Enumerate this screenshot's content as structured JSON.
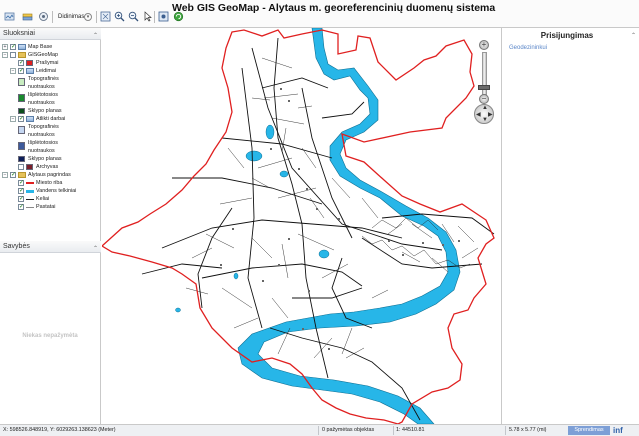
{
  "app": {
    "title": "Web GIS GeoMap - Alytaus m. georeferencinių duomenų sistema"
  },
  "toolbar": {
    "select_value": "Didinimas",
    "icons": [
      "home-icon",
      "layers-icon",
      "settings-icon",
      "zoom-extent-icon",
      "zoom-in-icon",
      "zoom-out-icon",
      "pointer-icon",
      "identify-icon",
      "refresh-icon"
    ]
  },
  "layers_panel": {
    "title": "Sluoksniai",
    "items": [
      {
        "label": "Map Base"
      },
      {
        "label": "GISGeoMap"
      },
      {
        "label": "Prašymai"
      },
      {
        "label": "Leidimai"
      },
      {
        "label": "Topografinės"
      },
      {
        "label": "nuotraukos"
      },
      {
        "label": "Išplėtotosios"
      },
      {
        "label": "nuotraukos"
      },
      {
        "label": "Sklypo planas"
      },
      {
        "label": "Atlikti darbai"
      },
      {
        "label": "Topografinės"
      },
      {
        "label": "nuotraukos"
      },
      {
        "label": "Išplėtotosios"
      },
      {
        "label": "nuotraukos"
      },
      {
        "label": "Sklypo planas"
      },
      {
        "label": "Archyvas"
      },
      {
        "label": "Alytaus pagrindas"
      },
      {
        "label": "Miesto riba"
      },
      {
        "label": "Vandens telkiniai"
      },
      {
        "label": "Keliai"
      },
      {
        "label": "Pastatai"
      }
    ],
    "colors": {
      "prasymai": "#e02020",
      "leidimai": "#e02020",
      "topo_leid": "#c8ecc0",
      "isplet_leid": "#1a8a2e",
      "sklypo_leid": "#0b4f1d",
      "topo_atl": "#c5d7f2",
      "isplet_atl": "#3d5a9c",
      "sklypo_atl": "#0e1f5a",
      "archyvas": "#7a1f2a",
      "miesto_riba": "#e02020",
      "vandens": "#27b6e8",
      "keliai": "#222222",
      "pastatai": "#888888"
    }
  },
  "properties_panel": {
    "title": "Savybės",
    "empty_text": "Niekas nepažymėta"
  },
  "right_panel": {
    "title": "Prisijungimas",
    "link": "Geodezininkui"
  },
  "map": {
    "boundary_color": "#e02020",
    "river_color": "#27b6e8",
    "road_color": "#111111"
  },
  "status": {
    "coords": "X: 598526.848919, Y: 6029263.138623 (Meter)",
    "selected": "0 pažymėtas objektas",
    "scale": "1: 44510.81",
    "extent": "5.78 x 5.77 (mi)",
    "button": "Sprendimas",
    "info": "inf"
  }
}
